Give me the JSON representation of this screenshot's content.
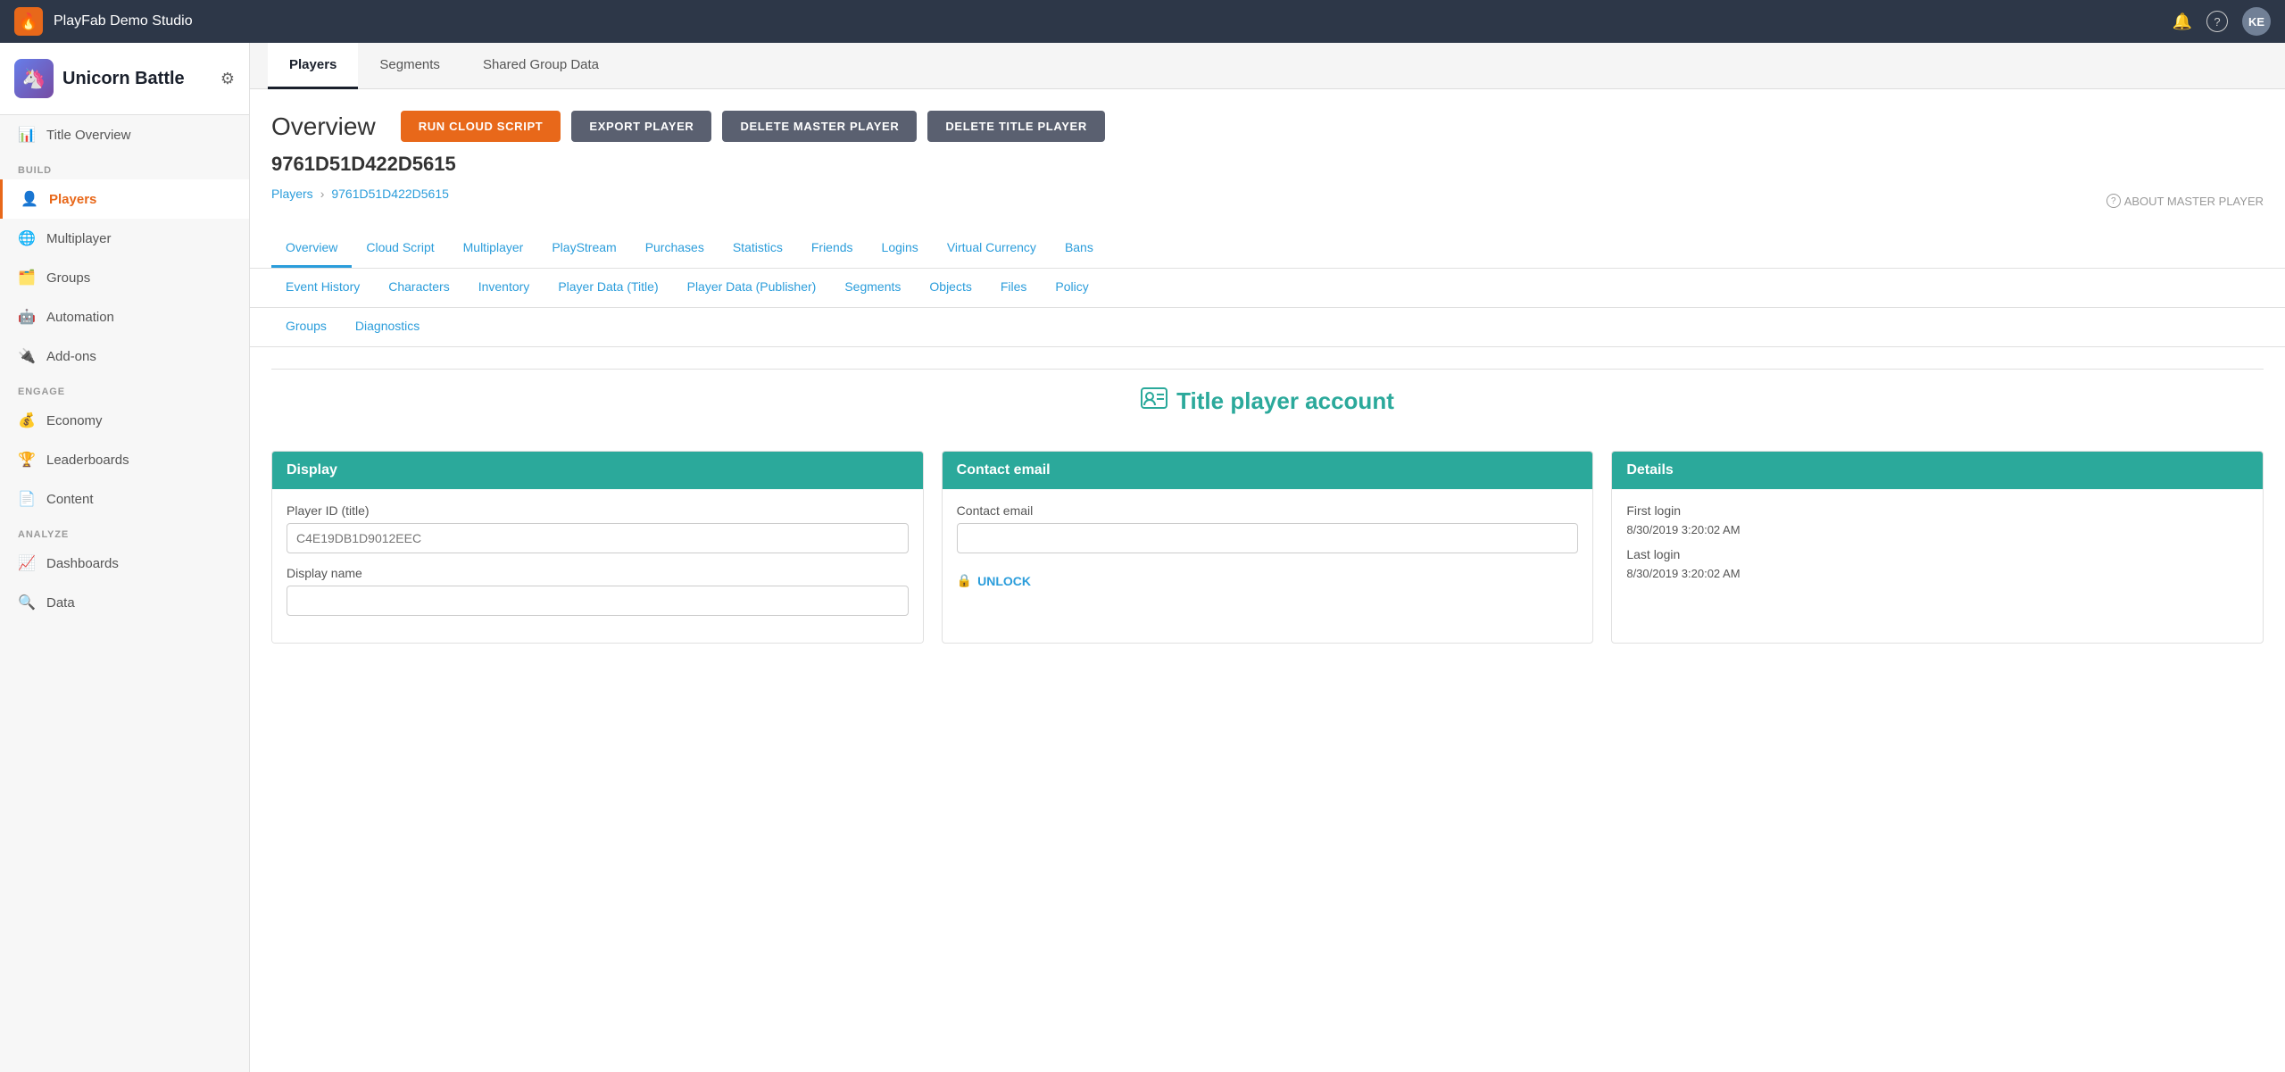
{
  "topNav": {
    "logo_icon": "🔥",
    "title": "PlayFab Demo Studio",
    "avatar_initials": "KE",
    "bell_icon": "🔔",
    "help_icon": "?"
  },
  "sidebar": {
    "game_icon": "🦄",
    "game_name": "Unicorn Battle",
    "sections": [
      {
        "label": "",
        "items": [
          {
            "id": "title-overview",
            "icon": "📊",
            "label": "Title Overview",
            "active": false
          }
        ]
      },
      {
        "label": "BUILD",
        "items": [
          {
            "id": "players",
            "icon": "👤",
            "label": "Players",
            "active": true
          },
          {
            "id": "multiplayer",
            "icon": "🌐",
            "label": "Multiplayer",
            "active": false
          },
          {
            "id": "groups",
            "icon": "🗂️",
            "label": "Groups",
            "active": false
          },
          {
            "id": "automation",
            "icon": "🤖",
            "label": "Automation",
            "active": false
          },
          {
            "id": "add-ons",
            "icon": "🔌",
            "label": "Add-ons",
            "active": false
          }
        ]
      },
      {
        "label": "ENGAGE",
        "items": [
          {
            "id": "economy",
            "icon": "💰",
            "label": "Economy",
            "active": false
          },
          {
            "id": "leaderboards",
            "icon": "🏆",
            "label": "Leaderboards",
            "active": false
          },
          {
            "id": "content",
            "icon": "📄",
            "label": "Content",
            "active": false
          }
        ]
      },
      {
        "label": "ANALYZE",
        "items": [
          {
            "id": "dashboards",
            "icon": "📈",
            "label": "Dashboards",
            "active": false
          },
          {
            "id": "data",
            "icon": "🔍",
            "label": "Data",
            "active": false
          }
        ]
      }
    ]
  },
  "pageTabs": {
    "tabs": [
      {
        "id": "players",
        "label": "Players",
        "active": true
      },
      {
        "id": "segments",
        "label": "Segments",
        "active": false
      },
      {
        "id": "shared-group-data",
        "label": "Shared Group Data",
        "active": false
      }
    ]
  },
  "overview": {
    "title": "Overview",
    "player_id": "9761D51D422D5615",
    "buttons": {
      "run_cloud_script": "RUN CLOUD SCRIPT",
      "export_player": "EXPORT PLAYER",
      "delete_master_player": "DELETE MASTER PLAYER",
      "delete_title_player": "DELETE TITLE PLAYER"
    },
    "breadcrumb": {
      "parent": "Players",
      "current": "9761D51D422D5615"
    },
    "about_master": "ABOUT MASTER PLAYER"
  },
  "playerTabs": {
    "row1": [
      {
        "id": "overview",
        "label": "Overview",
        "active": true
      },
      {
        "id": "cloud-script",
        "label": "Cloud Script",
        "active": false
      },
      {
        "id": "multiplayer",
        "label": "Multiplayer",
        "active": false
      },
      {
        "id": "playstream",
        "label": "PlayStream",
        "active": false
      },
      {
        "id": "purchases",
        "label": "Purchases",
        "active": false
      },
      {
        "id": "statistics",
        "label": "Statistics",
        "active": false
      },
      {
        "id": "friends",
        "label": "Friends",
        "active": false
      },
      {
        "id": "logins",
        "label": "Logins",
        "active": false
      },
      {
        "id": "virtual-currency",
        "label": "Virtual Currency",
        "active": false
      },
      {
        "id": "bans",
        "label": "Bans",
        "active": false
      }
    ],
    "row2": [
      {
        "id": "event-history",
        "label": "Event History",
        "active": false
      },
      {
        "id": "characters",
        "label": "Characters",
        "active": false
      },
      {
        "id": "inventory",
        "label": "Inventory",
        "active": false
      },
      {
        "id": "player-data-title",
        "label": "Player Data (Title)",
        "active": false
      },
      {
        "id": "player-data-publisher",
        "label": "Player Data (Publisher)",
        "active": false
      },
      {
        "id": "segments",
        "label": "Segments",
        "active": false
      },
      {
        "id": "objects",
        "label": "Objects",
        "active": false
      },
      {
        "id": "files",
        "label": "Files",
        "active": false
      },
      {
        "id": "policy",
        "label": "Policy",
        "active": false
      }
    ],
    "row3": [
      {
        "id": "groups",
        "label": "Groups",
        "active": false
      },
      {
        "id": "diagnostics",
        "label": "Diagnostics",
        "active": false
      }
    ]
  },
  "titlePlayerSection": {
    "icon": "👤",
    "title": "Title player account",
    "cards": {
      "display": {
        "header": "Display",
        "fields": [
          {
            "label": "Player ID (title)",
            "placeholder": "C4E19DB1D9012EEC",
            "type": "input"
          },
          {
            "label": "Display name",
            "placeholder": "",
            "type": "input"
          }
        ]
      },
      "contact_email": {
        "header": "Contact email",
        "fields": [
          {
            "label": "Contact email",
            "placeholder": "",
            "type": "input"
          }
        ],
        "unlock_label": "UNLOCK"
      },
      "details": {
        "header": "Details",
        "fields": [
          {
            "label": "First login",
            "value": "8/30/2019 3:20:02 AM"
          },
          {
            "label": "Last login",
            "value": "8/30/2019 3:20:02 AM"
          }
        ]
      }
    }
  }
}
